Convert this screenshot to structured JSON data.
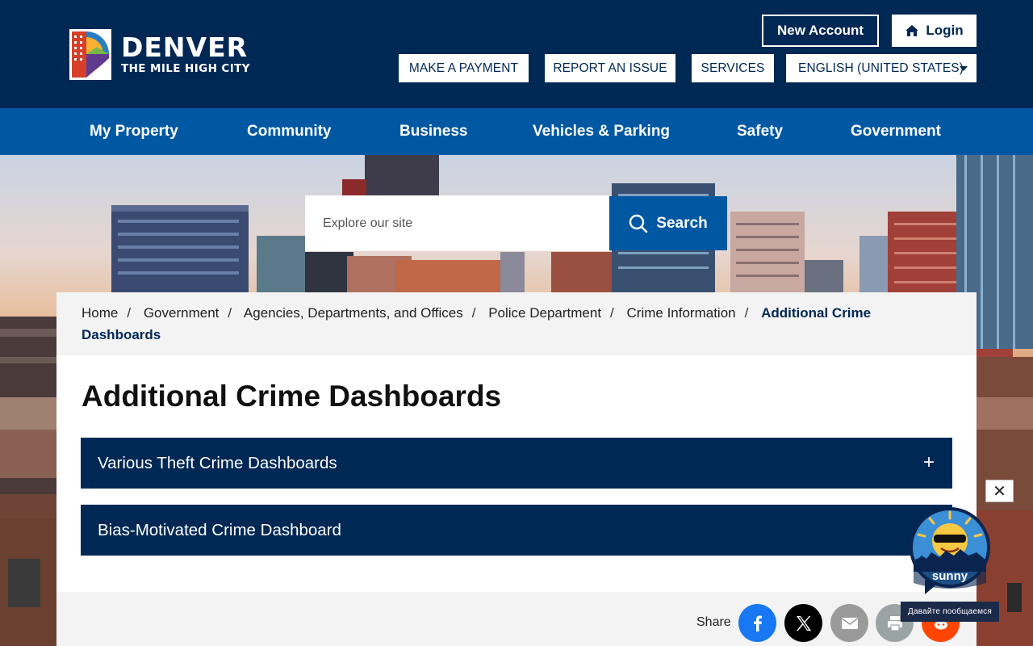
{
  "header": {
    "logo": {
      "title": "DENVER",
      "subtitle": "THE MILE HIGH CITY"
    },
    "new_account": "New Account",
    "login": "Login",
    "utility": {
      "make_payment": "MAKE A PAYMENT",
      "report_issue": "REPORT AN ISSUE",
      "services": "SERVICES",
      "language": "ENGLISH (UNITED STATES)"
    }
  },
  "nav": {
    "items": [
      "My Property",
      "Community",
      "Business",
      "Vehicles & Parking",
      "Safety",
      "Government"
    ]
  },
  "search": {
    "placeholder": "Explore our site",
    "button": "Search"
  },
  "breadcrumb": {
    "items": [
      "Home",
      "Government",
      "Agencies, Departments, and Offices",
      "Police Department",
      "Crime Information"
    ],
    "current": "Additional Crime Dashboards"
  },
  "main": {
    "title": "Additional Crime Dashboards",
    "accordions": [
      {
        "label": "Various Theft Crime Dashboards",
        "icon": "+"
      },
      {
        "label": "Bias-Motivated Crime Dashboard"
      }
    ]
  },
  "share": {
    "label": "Share",
    "buttons": [
      "facebook-icon",
      "x-icon",
      "email-icon",
      "print-icon",
      "reddit-icon"
    ]
  },
  "chat": {
    "close": "✕",
    "name": "sunny",
    "tagline": "Давайте пообщаемся"
  },
  "colors": {
    "navy": "#002855",
    "blue": "#0058a3",
    "light_gray": "#f3f3f3"
  }
}
